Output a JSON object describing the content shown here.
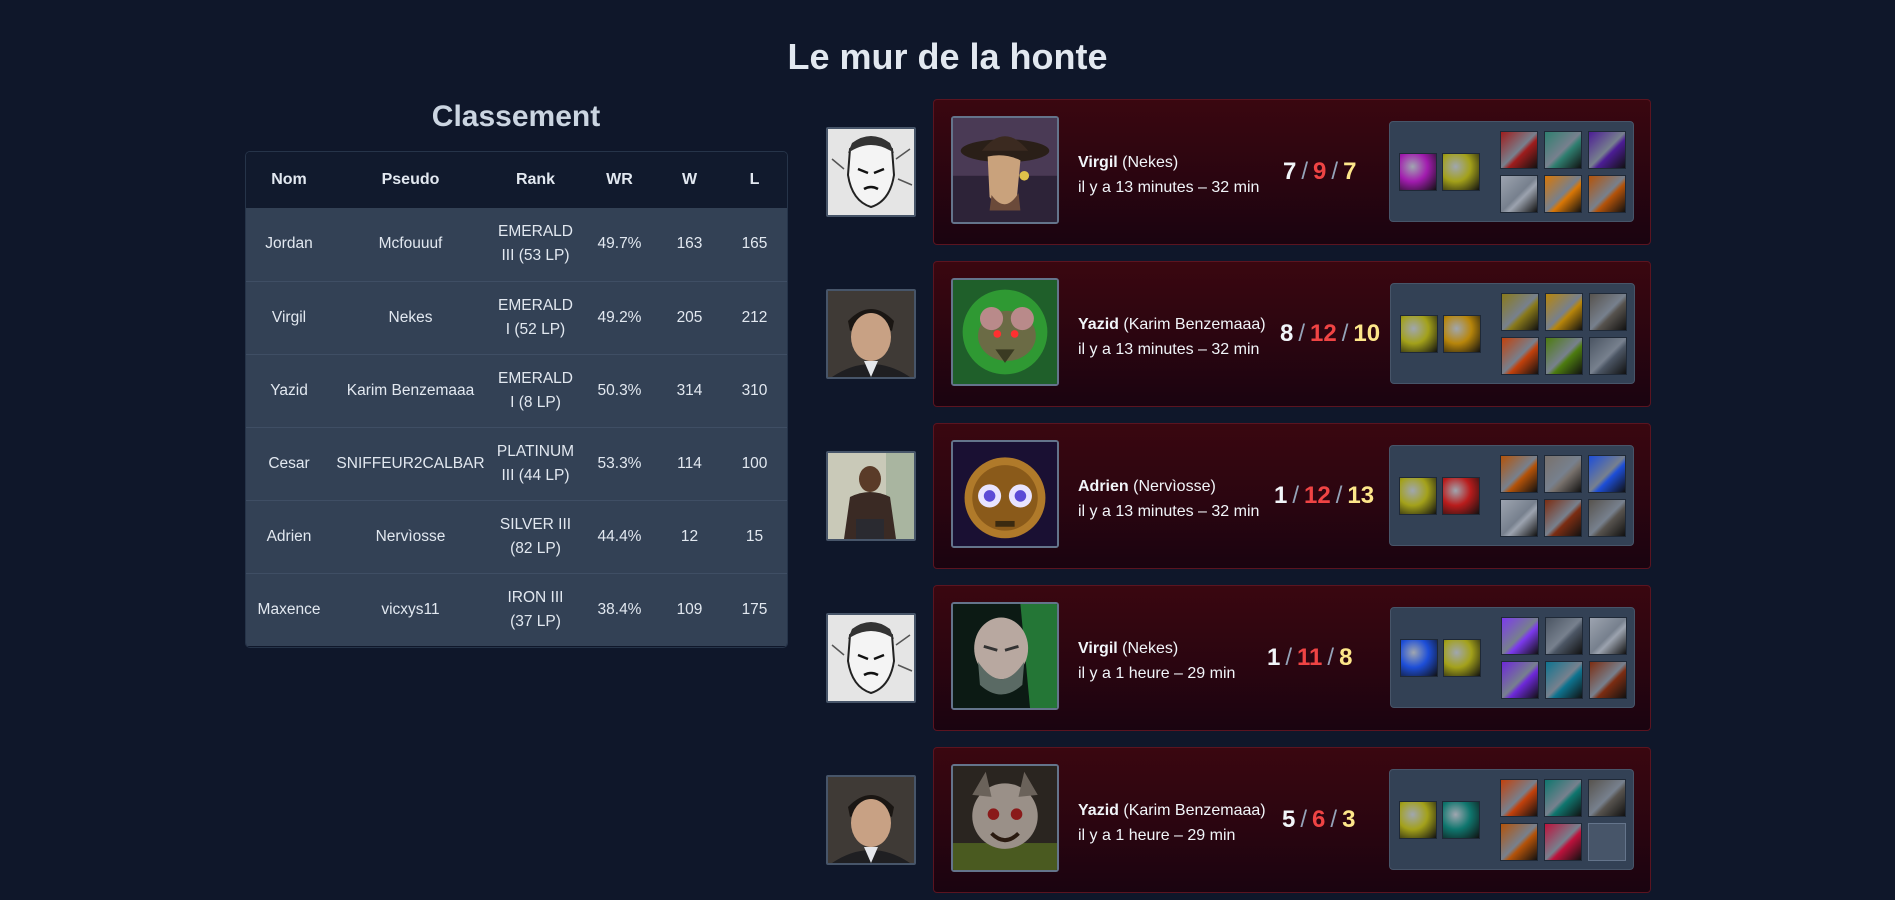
{
  "page": {
    "title": "Le mur de la honte"
  },
  "leaderboard": {
    "title": "Classement",
    "columns": [
      "Nom",
      "Pseudo",
      "Rank",
      "WR",
      "W",
      "L"
    ],
    "rows": [
      {
        "nom": "Jordan",
        "pseudo": "Mcfouuuf",
        "rank_line1": "EMERALD",
        "rank_line2": "III (53 LP)",
        "wr": "49.7%",
        "w": "163",
        "l": "165"
      },
      {
        "nom": "Virgil",
        "pseudo": "Nekes",
        "rank_line1": "EMERALD",
        "rank_line2": "I (52 LP)",
        "wr": "49.2%",
        "w": "205",
        "l": "212"
      },
      {
        "nom": "Yazid",
        "pseudo": "Karim Benzemaaa",
        "rank_line1": "EMERALD",
        "rank_line2": "I (8 LP)",
        "wr": "50.3%",
        "w": "314",
        "l": "310"
      },
      {
        "nom": "Cesar",
        "pseudo": "SNIFFEUR2CALBAR",
        "rank_line1": "PLATINUM",
        "rank_line2": "III (44 LP)",
        "wr": "53.3%",
        "w": "114",
        "l": "100"
      },
      {
        "nom": "Adrien",
        "pseudo": "Nervìosse",
        "rank_line1": "SILVER III",
        "rank_line2": "(82 LP)",
        "wr": "44.4%",
        "w": "12",
        "l": "15"
      },
      {
        "nom": "Maxence",
        "pseudo": "vicxys11",
        "rank_line1": "IRON III",
        "rank_line2": "(37 LP)",
        "wr": "38.4%",
        "w": "109",
        "l": "175"
      }
    ]
  },
  "games": [
    {
      "name": "Virgil",
      "pseudo": "(Nekes)",
      "time": "il y a 13 minutes – 32 min",
      "kills": "7",
      "deaths": "9",
      "assists": "7",
      "avatar_icon": "manga-portrait-icon",
      "champion_icon": "cowboy-hat-champion-icon",
      "spell_colors": [
        "#a21caf",
        "#a3a11a"
      ],
      "item_colors": [
        "#9f1d1d",
        "#2f7f70",
        "#4c1d95",
        "#9ca3af",
        "#d97706",
        "#b45309"
      ]
    },
    {
      "name": "Yazid",
      "pseudo": "(Karim Benzemaaa)",
      "time": "il y a 13 minutes – 32 min",
      "kills": "8",
      "deaths": "12",
      "assists": "10",
      "avatar_icon": "man-portrait-icon",
      "champion_icon": "rat-champion-icon",
      "spell_colors": [
        "#a3a11a",
        "#b8860b"
      ],
      "item_colors": [
        "#8a7a1a",
        "#b8860b",
        "#57534e",
        "#c2410c",
        "#4d7c0f",
        "#4b5563"
      ]
    },
    {
      "name": "Adrien",
      "pseudo": "(Nervìosse)",
      "time": "il y a 13 minutes – 32 min",
      "kills": "1",
      "deaths": "12",
      "assists": "13",
      "avatar_icon": "man-standing-icon",
      "champion_icon": "robot-champion-icon",
      "spell_colors": [
        "#a3a11a",
        "#b91c1c"
      ],
      "item_colors": [
        "#b45309",
        "#78716c",
        "#1d4ed8",
        "#9ca3af",
        "#7c2d12",
        "#57534e"
      ]
    },
    {
      "name": "Virgil",
      "pseudo": "(Nekes)",
      "time": "il y a 1 heure – 29 min",
      "kills": "1",
      "deaths": "11",
      "assists": "8",
      "avatar_icon": "manga-portrait-icon",
      "champion_icon": "masked-champion-icon",
      "spell_colors": [
        "#1d4ed8",
        "#a3a11a"
      ],
      "item_colors": [
        "#7c3aed",
        "#4b5563",
        "#9ca3af",
        "#6d28d9",
        "#0e7490",
        "#7c2d12"
      ]
    },
    {
      "name": "Yazid",
      "pseudo": "(Karim Benzemaaa)",
      "time": "il y a 1 heure – 29 min",
      "kills": "5",
      "deaths": "6",
      "assists": "3",
      "avatar_icon": "man-portrait-icon",
      "champion_icon": "beast-champion-icon",
      "spell_colors": [
        "#a3a11a",
        "#0f766e"
      ],
      "item_colors": [
        "#c2410c",
        "#0f766e",
        "#57534e",
        "#b45309",
        "#be123c",
        ""
      ]
    }
  ]
}
